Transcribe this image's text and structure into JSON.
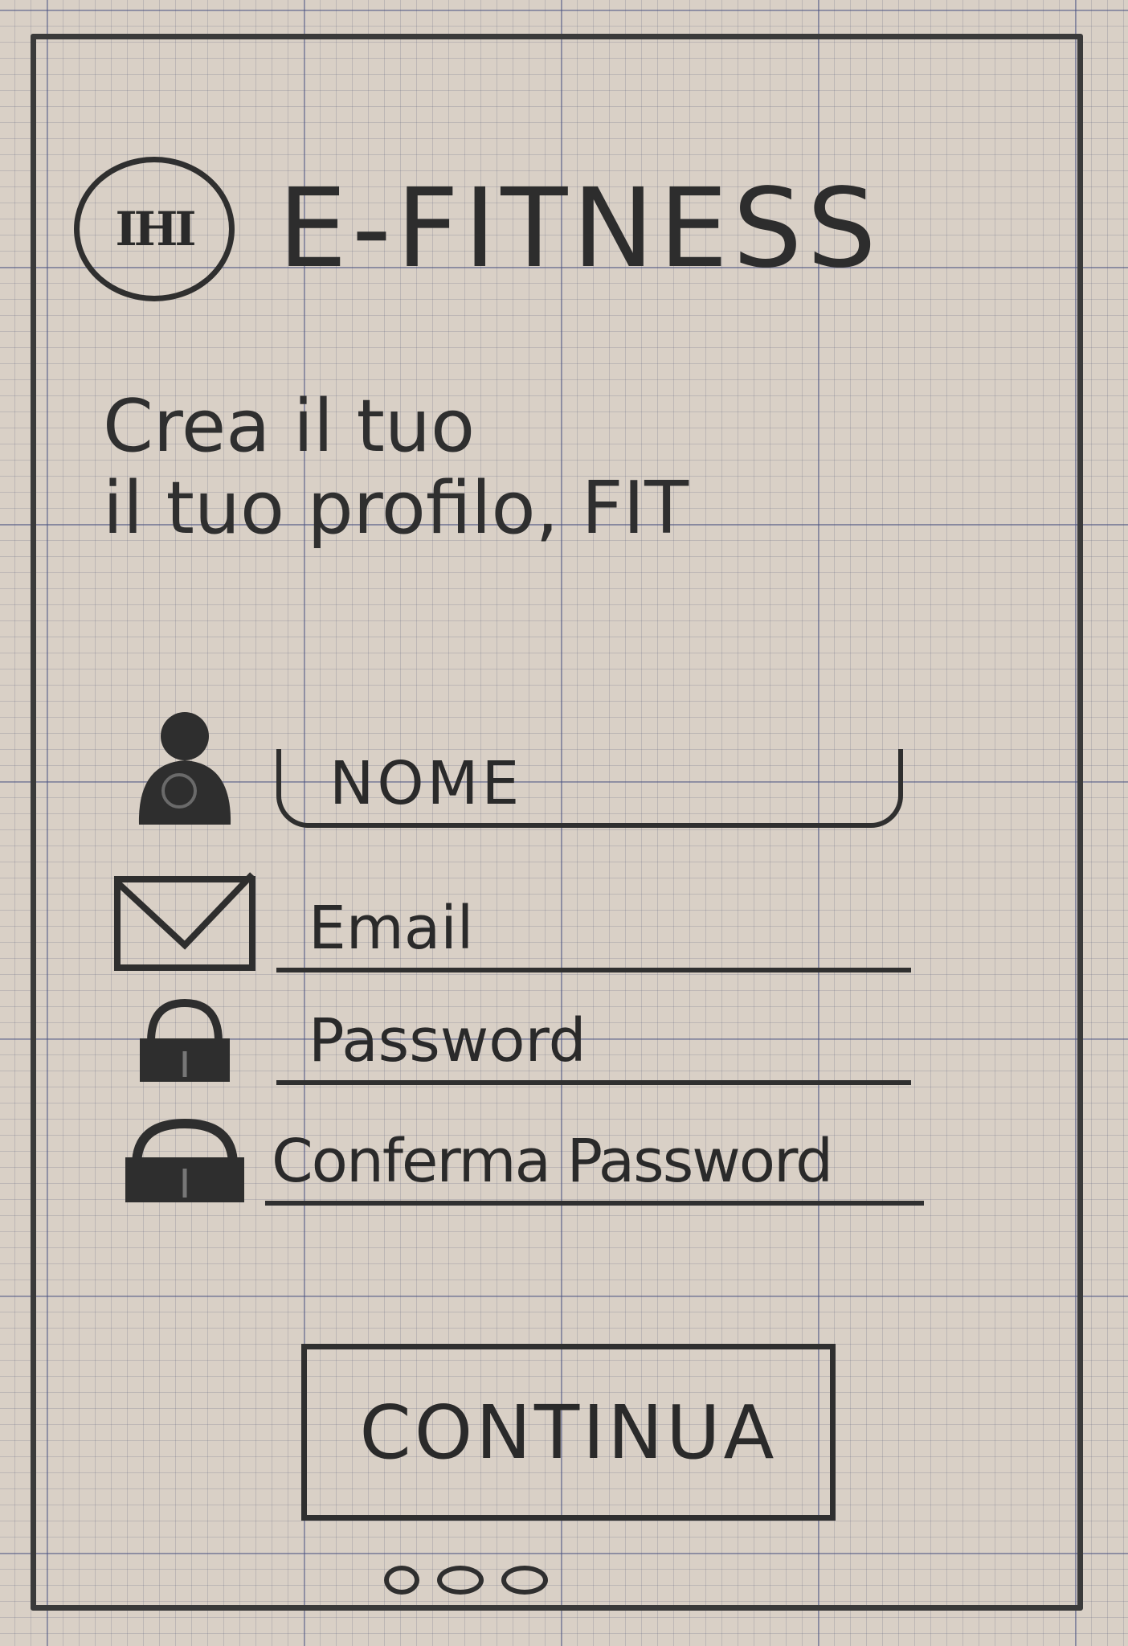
{
  "header": {
    "logo_text": "IHI",
    "app_title": "E-FITNESS"
  },
  "headline": {
    "line1": "Crea il tuo",
    "line2": "il tuo profilo, FIT"
  },
  "form": {
    "name_placeholder": "NOME",
    "email_placeholder": "Email",
    "password_placeholder": "Password",
    "confirm_password_placeholder": "Conferma Password",
    "icons": {
      "name": "user-icon",
      "email": "envelope-icon",
      "password": "lock-icon",
      "confirm_password": "lock-icon"
    }
  },
  "actions": {
    "continue_label": "CONTINUA"
  },
  "pagination": {
    "dots": 3
  }
}
